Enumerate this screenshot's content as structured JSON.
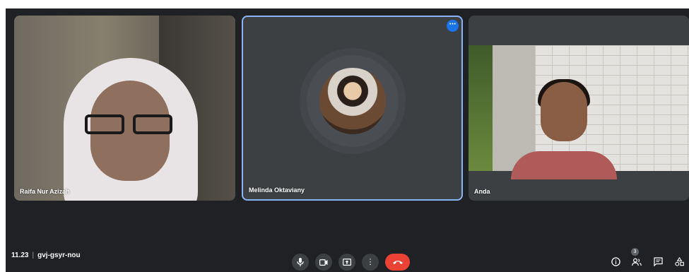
{
  "participants": [
    {
      "name": "Raifa Nur Azizah"
    },
    {
      "name": "Melinda Oktaviany"
    },
    {
      "name": "Anda"
    }
  ],
  "tile_more_icon": "more-horiz-icon",
  "meeting": {
    "time": "11.23",
    "separator": "|",
    "code": "gvj-gsyr-nou"
  },
  "controls": {
    "mic_icon": "mic-icon",
    "camera_icon": "videocam-icon",
    "present_icon": "present-screen-icon",
    "more_icon": "more-vert-icon",
    "end_call_icon": "call-end-icon"
  },
  "right_panel": {
    "info_icon": "info-icon",
    "people_icon": "people-icon",
    "people_count": "3",
    "chat_icon": "chat-icon",
    "activities_icon": "activities-icon"
  },
  "colors": {
    "background": "#202124",
    "tile": "#3c4043",
    "active_border": "#8ab4f8",
    "end_call": "#ea4335",
    "accent": "#1a73e8"
  }
}
